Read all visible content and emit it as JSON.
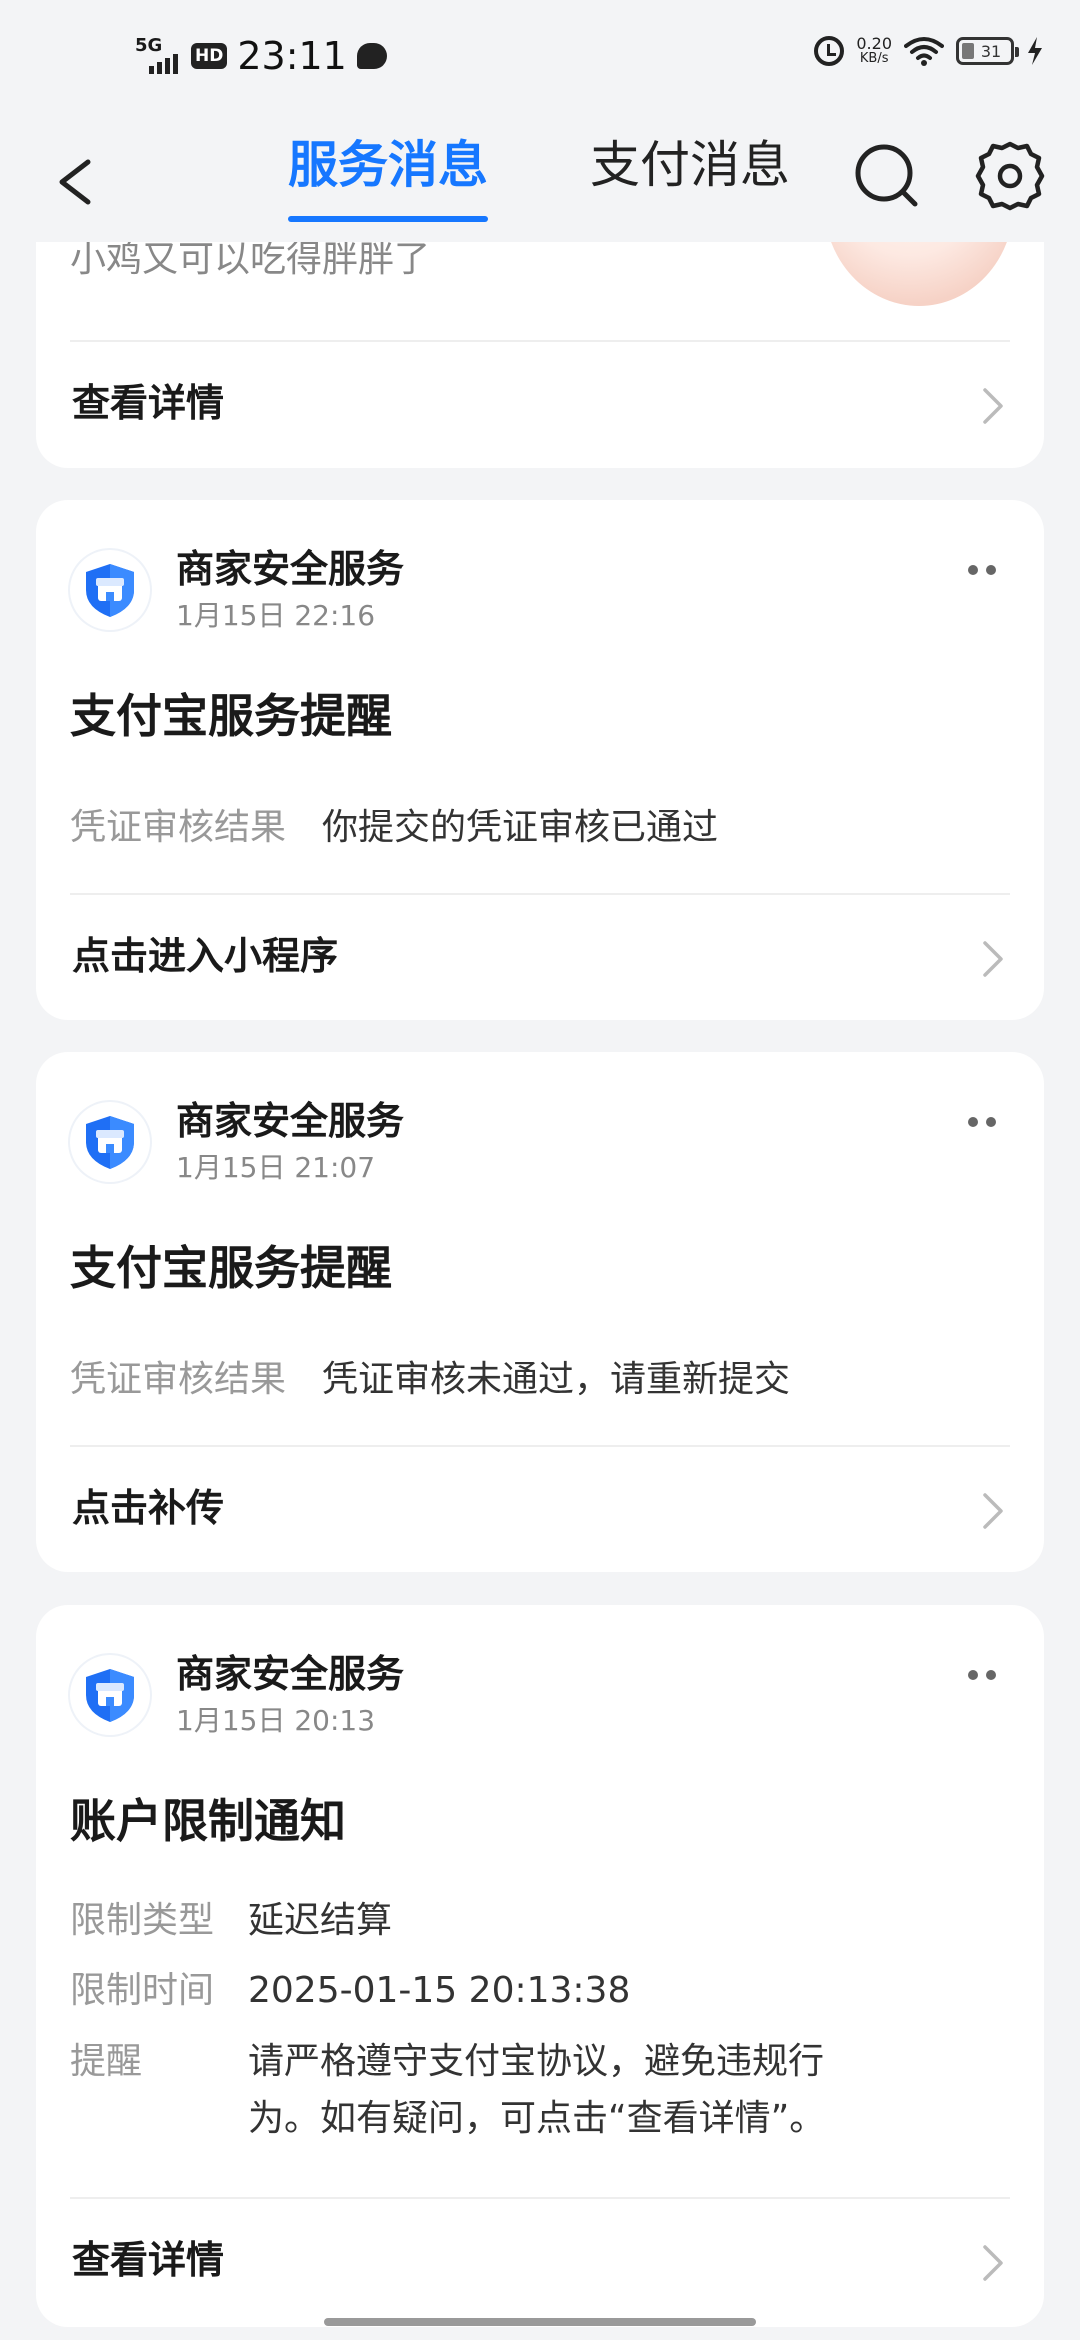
{
  "status_bar": {
    "network": "5G",
    "hd": "HD",
    "time": "23:11",
    "speed_value": "0.20",
    "speed_unit": "KB/s",
    "battery": "31"
  },
  "header": {
    "tab_service": "服务消息",
    "tab_payment": "支付消息",
    "active_tab": "服务消息",
    "accent_color": "#1677ff"
  },
  "partial_card": {
    "text": "小鸡又可以吃得胖胖了",
    "action": "查看详情"
  },
  "messages": [
    {
      "sender": "商家安全服务",
      "time": "1月15日 22:16",
      "title": "支付宝服务提醒",
      "fields": [
        {
          "label": "凭证审核结果",
          "value": "你提交的凭证审核已通过"
        }
      ],
      "action": "点击进入小程序"
    },
    {
      "sender": "商家安全服务",
      "time": "1月15日 21:07",
      "title": "支付宝服务提醒",
      "fields": [
        {
          "label": "凭证审核结果",
          "value": "凭证审核未通过，请重新提交"
        }
      ],
      "action": "点击补传"
    },
    {
      "sender": "商家安全服务",
      "time": "1月15日 20:13",
      "title": "账户限制通知",
      "fields": [
        {
          "label": "限制类型",
          "value": "延迟结算"
        },
        {
          "label": "限制时间",
          "value": "2025-01-15 20:13:38"
        },
        {
          "label": "提醒",
          "value": "请严格遵守支付宝协议，避免违规行为。如有疑问，可点击“查看详情”。"
        }
      ],
      "action": "查看详情"
    }
  ],
  "icons": {
    "back": "chevron-left-icon",
    "search": "search-icon",
    "settings": "gear-icon",
    "sender": "shield-store-icon",
    "more": "more-dots-icon",
    "chevron": "chevron-right-icon"
  }
}
